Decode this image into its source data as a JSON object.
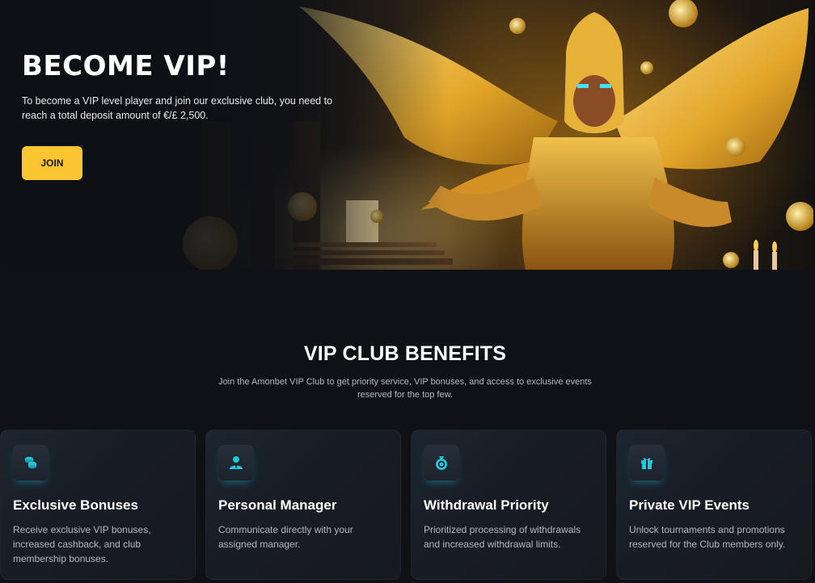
{
  "hero": {
    "title": "BECOME VIP!",
    "description": "To become a VIP level player and join our exclusive club, you need to reach a total deposit amount of €/£ 2,500.",
    "join_label": "JOIN",
    "accent_color": "#fbc531"
  },
  "benefits": {
    "title": "VIP CLUB BENEFITS",
    "subtitle": "Join the Amonbet VIP Club to get priority service, VIP bonuses, and access to exclusive events reserved for the top few.",
    "icon_color": "#26c6da",
    "cards": [
      {
        "icon": "coins-icon",
        "title": "Exclusive Bonuses",
        "text": "Receive exclusive VIP bonuses, increased cashback, and club membership bonuses."
      },
      {
        "icon": "manager-icon",
        "title": "Personal Manager",
        "text": "Communicate directly with your assigned manager."
      },
      {
        "icon": "money-bag-icon",
        "title": "Withdrawal Priority",
        "text": "Prioritized processing of withdrawals and increased withdrawal limits."
      },
      {
        "icon": "gift-icon",
        "title": "Private VIP Events",
        "text": "Unlock tournaments and promotions reserved for the Club members only."
      }
    ]
  }
}
